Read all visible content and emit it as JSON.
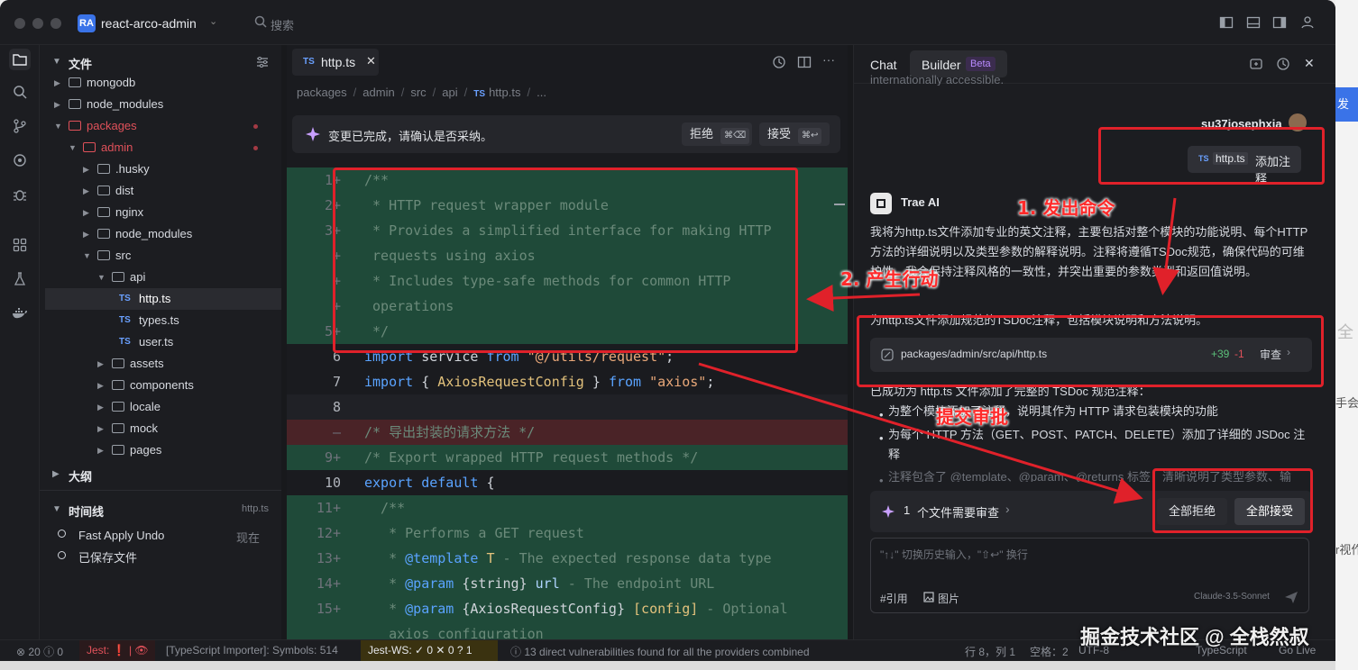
{
  "titlebar": {
    "project_badge": "RA",
    "project_name": "react-arco-admin",
    "search_placeholder": "搜索"
  },
  "explorer": {
    "files_title": "文件",
    "tree": [
      {
        "label": "mongodb"
      },
      {
        "label": "node_modules"
      },
      {
        "label": "packages"
      },
      {
        "label": "admin"
      },
      {
        "label": ".husky"
      },
      {
        "label": "dist"
      },
      {
        "label": "nginx"
      },
      {
        "label": "node_modules"
      },
      {
        "label": "src"
      },
      {
        "label": "api"
      },
      {
        "label": "http.ts"
      },
      {
        "label": "types.ts"
      },
      {
        "label": "user.ts"
      },
      {
        "label": "assets"
      },
      {
        "label": "components"
      },
      {
        "label": "locale"
      },
      {
        "label": "mock"
      },
      {
        "label": "pages"
      }
    ],
    "ts_tag": "TS",
    "outline_title": "大纲",
    "timeline_title": "时间线",
    "timeline_file": "http.ts",
    "timeline_items": [
      {
        "label": "Fast Apply Undo",
        "time": "现在"
      },
      {
        "label": "已保存文件",
        "time": ""
      }
    ]
  },
  "editor": {
    "tab_label": "http.ts",
    "breadcrumb": [
      "packages",
      "/",
      "admin",
      "/",
      "src",
      "/",
      "api",
      "/",
      "TS",
      "http.ts",
      "/",
      "..."
    ],
    "banner_text": "变更已完成，请确认是否采纳。",
    "reject_label": "拒绝",
    "reject_kbd": "⌘⌫",
    "accept_label": "接受",
    "accept_kbd": "⌘↩",
    "lines": [
      {
        "ln": "1+",
        "text": "/**"
      },
      {
        "ln": "2+",
        "text": " * HTTP request wrapper module"
      },
      {
        "ln": "3+",
        "text": " * Provides a simplified interface for making HTTP"
      },
      {
        "ln": "+",
        "text": " requests using axios"
      },
      {
        "ln": "+",
        "text": " * Includes type-safe methods for common HTTP"
      },
      {
        "ln": "+",
        "text": " operations"
      },
      {
        "ln": "5+",
        "text": " */"
      },
      {
        "ln": "6",
        "kw1": "import",
        "p1": " service ",
        "kw2": "from",
        "s": " \"@/utils/request\"",
        "p2": ";"
      },
      {
        "ln": "7",
        "kw1": "import",
        "p1": " { ",
        "ty": "AxiosRequestConfig",
        "p3": " } ",
        "kw2": "from",
        "s": " \"axios\"",
        "p2": ";"
      },
      {
        "ln": "8",
        "text": ""
      },
      {
        "ln": "–",
        "text": "/* 导出封装的请求方法 */"
      },
      {
        "ln": "9+",
        "text": "/* Export wrapped HTTP request methods */"
      },
      {
        "ln": "10",
        "kw1": "export",
        "kw2": " default",
        "p2": " {"
      },
      {
        "ln": "11+",
        "text": "  /**"
      },
      {
        "ln": "12+",
        "text": "   * Performs a GET request"
      },
      {
        "ln": "13+",
        "tag": "@template",
        "ty": " T",
        "text": " - The expected response data type"
      },
      {
        "ln": "14+",
        "tag": "@param",
        "p1": " {string} ",
        "id": "url",
        "text": " - The endpoint URL"
      },
      {
        "ln": "15+",
        "tag": "@param",
        "p1": " {AxiosRequestConfig} ",
        "ty": "[config]",
        "text": " - Optional"
      },
      {
        "ln": "",
        "text": "   axios configuration"
      }
    ]
  },
  "chat": {
    "tab_chat": "Chat",
    "tab_builder": "Builder",
    "beta": "Beta",
    "top_partial": "internationally accessible.",
    "user_name": "su37josephxia",
    "user_chip_ts": "TS",
    "user_chip_file": "http.ts",
    "user_chip_text": "添加注释",
    "ai_name": "Trae AI",
    "ai_para1": "我将为http.ts文件添加专业的英文注释，主要包括对整个模块的功能说明、每个HTTP方法的详细说明以及类型参数的解释说明。注释将遵循TSDoc规范，确保代码的可维护性。我会保持注释风格的一致性，并突出重要的参数类型和返回值说明。",
    "ai_para2": "为http.ts文件添加规范的TSDoc注释，包括模块说明和方法说明。",
    "file_path": "packages/admin/src/api/http.ts",
    "file_add": "+39",
    "file_del": "-1",
    "file_review": "审查",
    "done_text": "已成功为 http.ts 文件添加了完整的 TSDoc 规范注释：",
    "bullet1": "为整个模块添加了注释，说明其作为 HTTP 请求包装模块的功能",
    "bullet2": "为每个 HTTP 方法（GET、POST、PATCH、DELETE）添加了详细的 JSDoc 注释",
    "bullet3": "注释包含了 @template、@param、@returns 标签，清晰说明了类型参数、输",
    "review_count": "1",
    "review_text": "个文件需要审查",
    "reject_all": "全部拒绝",
    "accept_all": "全部接受",
    "input_placeholder": "\"↑↓\" 切换历史输入，\"⇧↩\" 换行",
    "ref_label": "#引用",
    "img_label": "图片",
    "model": "Claude-3.5-Sonnet"
  },
  "annotations": {
    "a1": "1. 发出命令",
    "a2": "2. 产生行动",
    "a3": "提交审批"
  },
  "status": {
    "errors": "20",
    "warnings": "0",
    "jest": "Jest:",
    "ts_importer": "[TypeScript Importer]: Symbols: 514",
    "jest_ws": "Jest-WS:",
    "jest_ws_pass": "0",
    "jest_ws_fail": "0",
    "jest_ws_skip": "1",
    "vuln": "13 direct vulnerabilities found for all the providers combined",
    "position": "行 8，列 1",
    "spaces": "空格：2",
    "encoding": "UTF-8",
    "lang": "TypeScript",
    "golive": "Go Live"
  },
  "outside": {
    "publish": "发布",
    "c1": "全",
    "c2": "手会",
    "c3": "r视作"
  },
  "watermark": "掘金技术社区 @ 全栈然叔",
  "colors": {
    "added_bg": "#1f4a39",
    "removed_bg": "#4a2327",
    "accent": "#3a73e8",
    "annotation": "#e0212a"
  }
}
